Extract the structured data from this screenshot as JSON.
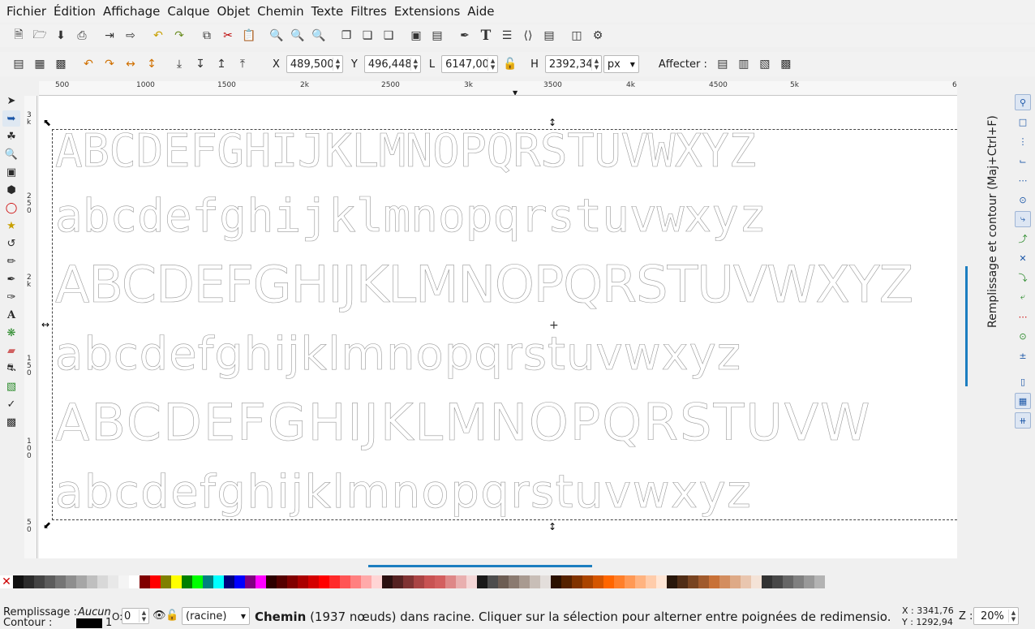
{
  "menu": [
    "Fichier",
    "Édition",
    "Affichage",
    "Calque",
    "Objet",
    "Chemin",
    "Texte",
    "Filtres",
    "Extensions",
    "Aide"
  ],
  "control_bar": {
    "x_label": "X",
    "x_value": "489,500",
    "y_label": "Y",
    "y_value": "496,448",
    "w_label": "L",
    "w_value": "6147,00",
    "h_label": "H",
    "h_value": "2392,34",
    "unit": "px",
    "affect_label": "Affecter :"
  },
  "rulers": {
    "horizontal": [
      "500",
      "1000",
      "1500",
      "2k",
      "2500",
      "3k",
      "3500",
      "4k",
      "4500",
      "5k",
      "6"
    ],
    "vertical": [
      "3 k",
      "2 5 0",
      "2 k",
      "1 5 0",
      "1 0 0",
      "5 0"
    ]
  },
  "canvas": {
    "line1": "ABCDEFGHIJKLMNOPQRSTUVWXYZ",
    "line2": "abcdefghijklmnopqrstuvwxyz",
    "line3": "ABCDEFGHIJKLMNOPQRSTUVWXYZ",
    "line4": "abcdefghijklmnopqrstuvwxyz",
    "line5": "ABCDEFGHIJKLMNOPQRSTUVW",
    "line6": "abcdefghijklmnopqrstuvwxyz"
  },
  "dialog": {
    "title": "Remplissage et contour (Maj+Ctrl+F)"
  },
  "palette": [
    "#111111",
    "#2b2b2b",
    "#444444",
    "#5c5c5c",
    "#757575",
    "#8e8e8e",
    "#a6a6a6",
    "#bfbfbf",
    "#d8d8d8",
    "#e8e8e8",
    "#f4f4f4",
    "#ffffff",
    "#800000",
    "#ff0000",
    "#808000",
    "#ffff00",
    "#008000",
    "#00ff00",
    "#008080",
    "#00ffff",
    "#000080",
    "#0000ff",
    "#800080",
    "#ff00ff",
    "#2d0000",
    "#550000",
    "#800000",
    "#aa0000",
    "#d40000",
    "#ff0000",
    "#ff2a2a",
    "#ff5555",
    "#ff8080",
    "#ffaaaa",
    "#ffd5d5",
    "#2b1111",
    "#552222",
    "#803333",
    "#aa4444",
    "#c85353",
    "#d35f5f",
    "#de8787",
    "#e9afaf",
    "#f4d7d7",
    "#1a1a1a",
    "#4d4d4d",
    "#6c5d53",
    "#8a7a70",
    "#a89a90",
    "#c8beb7",
    "#e3dedb",
    "#2b1100",
    "#552200",
    "#803300",
    "#aa4400",
    "#d45500",
    "#ff6600",
    "#ff7f2a",
    "#ff9955",
    "#ffb380",
    "#ffccaa",
    "#ffe6d5",
    "#28170b",
    "#502d16",
    "#784421",
    "#a05a2c",
    "#c87137",
    "#d38d5f",
    "#deaa87",
    "#e9c6af",
    "#f4e3d7",
    "#333333",
    "#484848",
    "#666666",
    "#808080",
    "#999999",
    "#b3b3b3"
  ],
  "status": {
    "fill_label": "Remplissage :",
    "fill_value": "Aucun",
    "stroke_label": "Contour :",
    "stroke_width": "1",
    "opacity_label": "O:",
    "opacity_value": "0",
    "layer": "(racine)",
    "message_bold": "Chemin",
    "message": " (1937 nœuds) dans racine. Cliquer sur la sélection pour alterner entre poignées de redimensio.",
    "x_coord": "X : 3341,76",
    "y_coord": "Y : 1292,94",
    "zoom_label": "Z :",
    "zoom_value": "20%"
  }
}
